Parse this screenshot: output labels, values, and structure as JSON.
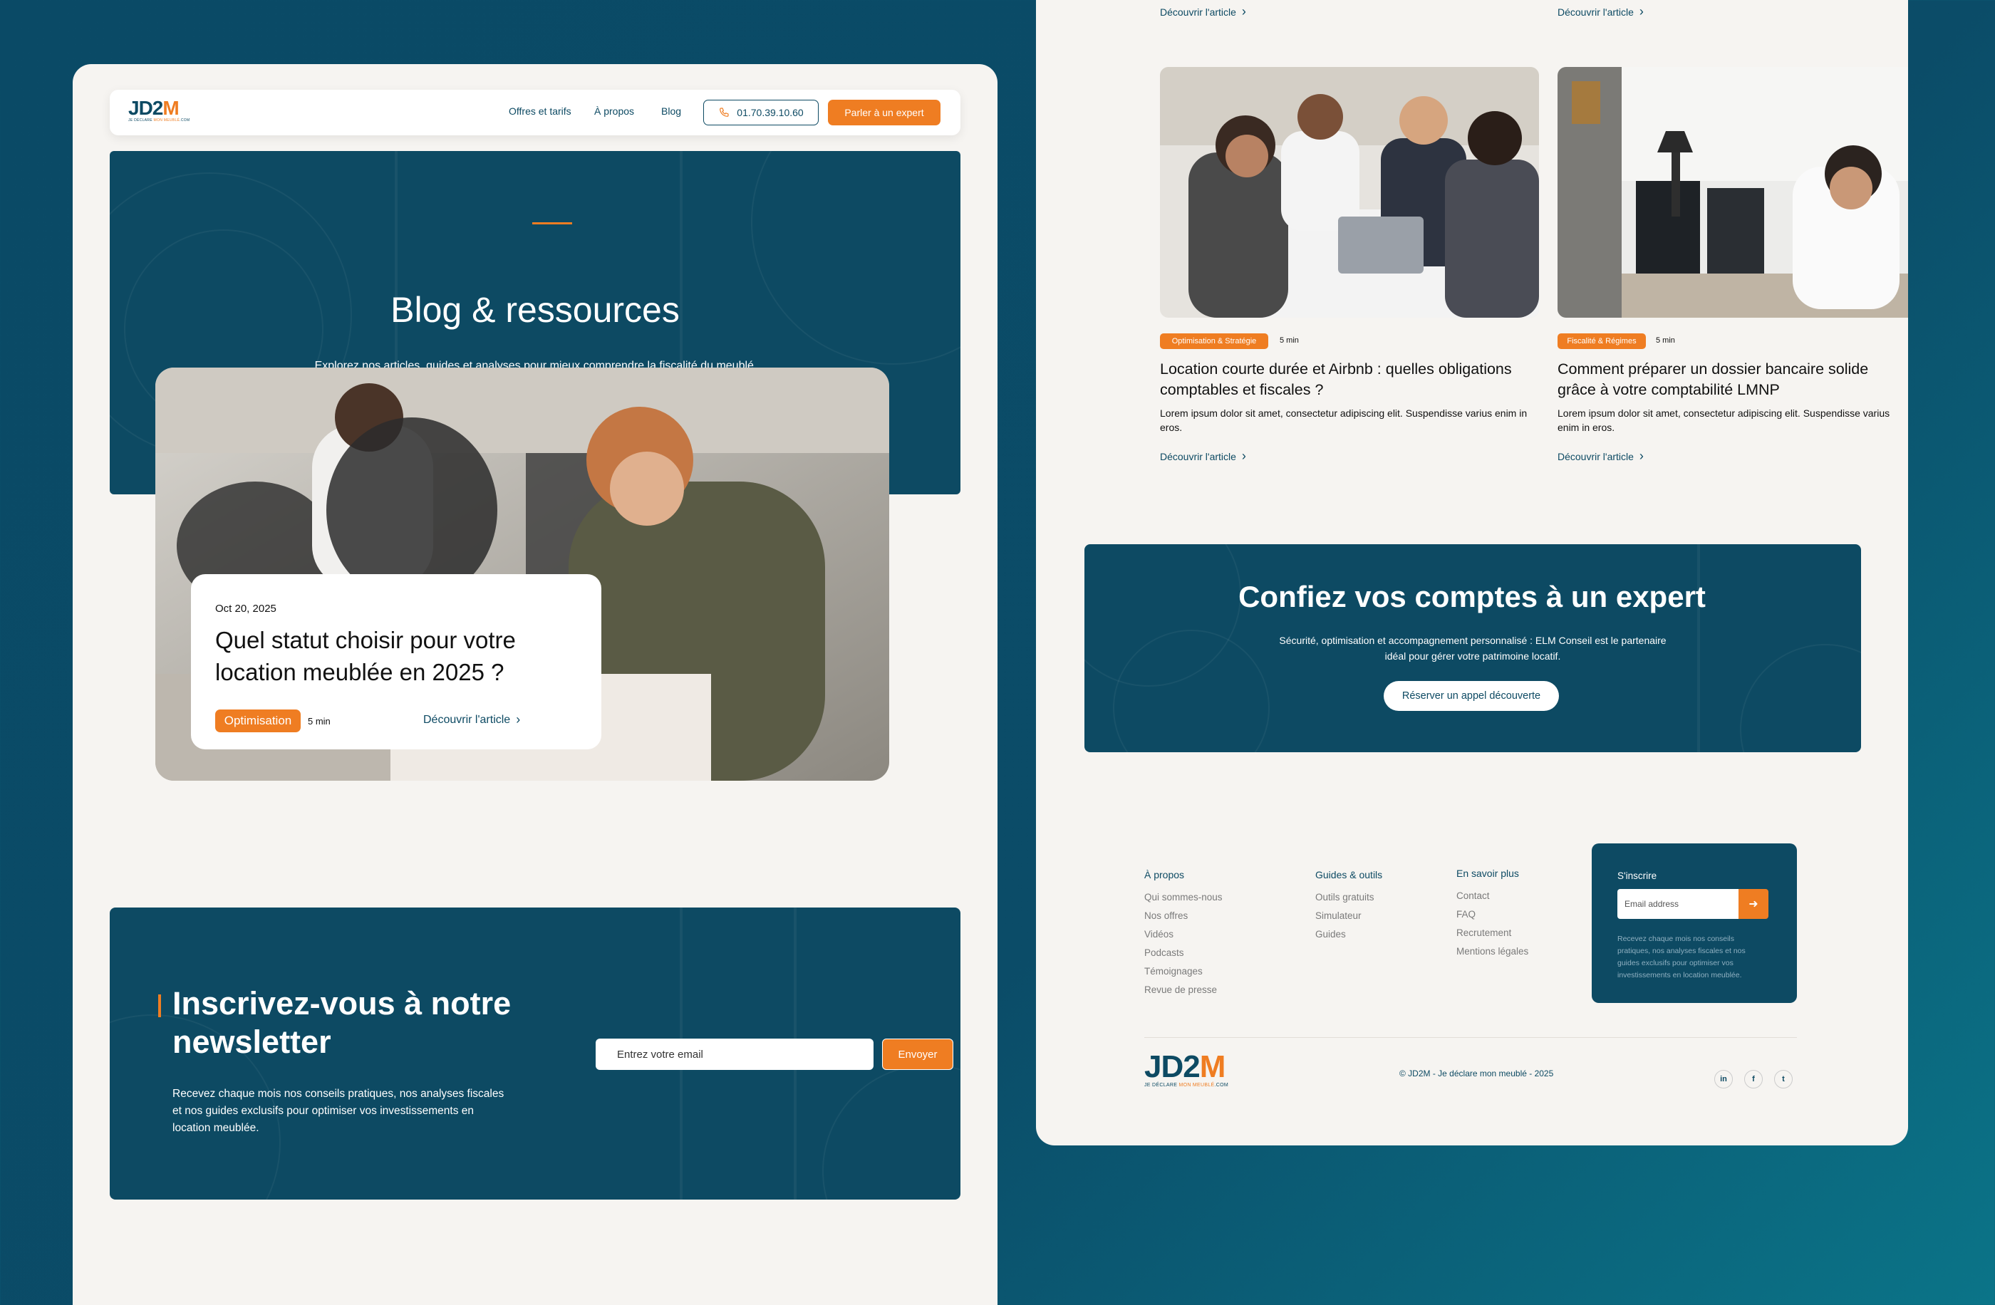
{
  "colors": {
    "brand": "#0d4a63",
    "accent": "#ef7d22",
    "page_bg": "#f6f4f1"
  },
  "brand": {
    "logo_main": "JD2M",
    "logo_prefix": "JD2",
    "logo_suffix": "M",
    "tagline_a": "JE DÉCLARE ",
    "tagline_b": "MON MEUBLÉ",
    "tagline_c": ".COM"
  },
  "nav": {
    "items": [
      "Offres et tarifs",
      "À propos",
      "Blog"
    ],
    "phone": "01.70.39.10.60",
    "phone_icon": "phone-icon",
    "cta": "Parler à un expert"
  },
  "hero": {
    "title": "Blog & ressources",
    "description": "Explorez nos articles, guides et analyses pour mieux comprendre la fiscalité du meublé, éviter les erreurs courantes et découvrir des stratégies concrètes."
  },
  "featured": {
    "date": "Oct 20, 2025",
    "title": "Quel statut choisir pour votre location meublée en 2025 ?",
    "tag": "Optimisation",
    "read_time": "5 min",
    "link": "Découvrir l'article"
  },
  "newsletter": {
    "title": "Inscrivez-vous à notre newsletter",
    "description": "Recevez chaque mois nos conseils pratiques, nos analyses fiscales et nos guides exclusifs pour optimiser vos investissements en location meublée.",
    "placeholder": "Entrez votre email",
    "button": "Envoyer"
  },
  "articles": [
    {
      "tag": "Optimisation & Stratégie",
      "read_time": "5 min",
      "title": "Location courte durée et Airbnb : quelles obligations comptables et fiscales ?",
      "excerpt": "Lorem ipsum dolor sit amet, consectetur adipiscing elit. Suspendisse varius enim in eros.",
      "link": "Découvrir l'article"
    },
    {
      "tag": "Fiscalité & Régimes",
      "read_time": "5 min",
      "title": "Comment préparer un dossier bancaire solide grâce à votre comptabilité LMNP",
      "excerpt": "Lorem ipsum dolor sit amet, consectetur adipiscing elit. Suspendisse varius enim in eros.",
      "link": "Découvrir l'article"
    }
  ],
  "top_links": [
    "Découvrir l'article",
    "Découvrir l'article"
  ],
  "cta": {
    "title": "Confiez vos comptes à un expert",
    "description": "Sécurité, optimisation et accompagnement personnalisé : ELM Conseil est le partenaire idéal pour gérer votre patrimoine locatif.",
    "button": "Réserver un appel découverte"
  },
  "footer": {
    "columns": [
      {
        "title": "À propos",
        "links": [
          "Qui sommes-nous",
          "Nos offres",
          "Vidéos",
          "Podcasts",
          "Témoignages",
          "Revue de presse"
        ]
      },
      {
        "title": "Guides & outils",
        "links": [
          "Outils gratuits",
          "Simulateur",
          "Guides"
        ]
      },
      {
        "title": "En savoir plus",
        "links": [
          "Contact",
          "FAQ",
          "Recrutement",
          "Mentions légales"
        ]
      }
    ],
    "subscribe": {
      "title": "S'inscrire",
      "placeholder": "Email address",
      "description": "Recevez chaque mois nos conseils pratiques, nos analyses fiscales et nos guides exclusifs pour optimiser vos investissements en location meublée."
    },
    "copyright": "© JD2M - Je déclare mon meublé - 2025",
    "social": [
      "in",
      "f",
      "t"
    ]
  }
}
